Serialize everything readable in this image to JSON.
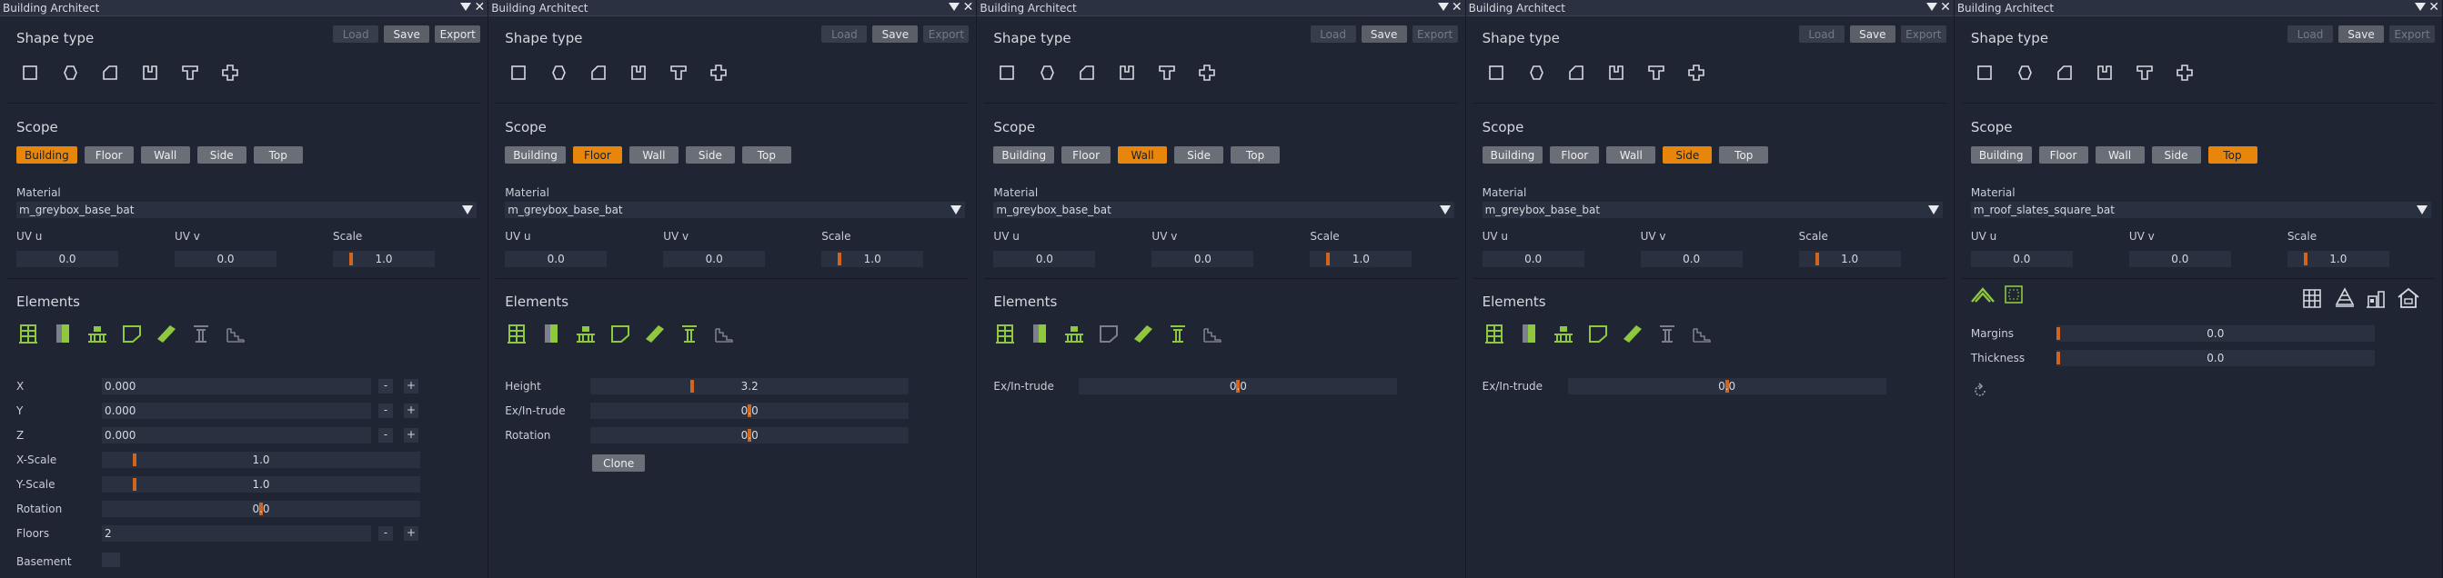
{
  "colors": {
    "accent": "#e8860c",
    "slider_mark": "#d0651f",
    "panel_bg": "#1f2533",
    "field_bg": "#293040",
    "button": "#6a6e76",
    "icon_green": "#8fc83e",
    "icon_gray": "#7b808a"
  },
  "panels": [
    {
      "title": "Building Architect",
      "buttons": {
        "load": "Load",
        "save": "Save",
        "export": "Export"
      },
      "shape_type_title": "Shape type",
      "scope_title": "Scope",
      "scopes": [
        "Building",
        "Floor",
        "Wall",
        "Side",
        "Top"
      ],
      "active_scope": "Building",
      "material_label": "Material",
      "material": "m_greybox_base_bat",
      "uv_u_label": "UV u",
      "uv_u": "0.0",
      "uv_v_label": "UV v",
      "uv_v": "0.0",
      "scale_label": "Scale",
      "scale": "1.0",
      "elements_title": "Elements",
      "props": [
        {
          "label": "X",
          "value": "0.000",
          "minus": "-",
          "plus": "+"
        },
        {
          "label": "Y",
          "value": "0.000",
          "minus": "-",
          "plus": "+"
        },
        {
          "label": "Z",
          "value": "0.000",
          "minus": "-",
          "plus": "+"
        }
      ],
      "sliders": [
        {
          "label": "X-Scale",
          "value": "1.0",
          "level": 0.1
        },
        {
          "label": "Y-Scale",
          "value": "1.0",
          "level": 0.1
        },
        {
          "label": "Rotation",
          "value": "0.0",
          "level": 0.5
        }
      ],
      "floors": {
        "label": "Floors",
        "value": "2",
        "minus": "-",
        "plus": "+"
      },
      "basement_label": "Basement"
    },
    {
      "title": "Building Architect",
      "buttons": {
        "load": "Load",
        "save": "Save",
        "export": "Export"
      },
      "shape_type_title": "Shape type",
      "scope_title": "Scope",
      "scopes": [
        "Building",
        "Floor",
        "Wall",
        "Side",
        "Top"
      ],
      "active_scope": "Floor",
      "material_label": "Material",
      "material": "m_greybox_base_bat",
      "uv_u_label": "UV u",
      "uv_u": "0.0",
      "uv_v_label": "UV v",
      "uv_v": "0.0",
      "scale_label": "Scale",
      "scale": "1.0",
      "elements_title": "Elements",
      "sliders": [
        {
          "label": "Height",
          "value": "3.2",
          "level": 0.32
        },
        {
          "label": "Ex/In-trude",
          "value": "0.0",
          "level": 0.5
        },
        {
          "label": "Rotation",
          "value": "0.0",
          "level": 0.5
        }
      ],
      "clone_label": "Clone"
    },
    {
      "title": "Building Architect",
      "buttons": {
        "load": "Load",
        "save": "Save",
        "export": "Export"
      },
      "shape_type_title": "Shape type",
      "scope_title": "Scope",
      "scopes": [
        "Building",
        "Floor",
        "Wall",
        "Side",
        "Top"
      ],
      "active_scope": "Wall",
      "material_label": "Material",
      "material": "m_greybox_base_bat",
      "uv_u_label": "UV u",
      "uv_u": "0.0",
      "uv_v_label": "UV v",
      "uv_v": "0.0",
      "scale_label": "Scale",
      "scale": "1.0",
      "elements_title": "Elements",
      "sliders": [
        {
          "label": "Ex/In-trude",
          "value": "0.0",
          "level": 0.5
        }
      ]
    },
    {
      "title": "Building Architect",
      "buttons": {
        "load": "Load",
        "save": "Save",
        "export": "Export"
      },
      "shape_type_title": "Shape type",
      "scope_title": "Scope",
      "scopes": [
        "Building",
        "Floor",
        "Wall",
        "Side",
        "Top"
      ],
      "active_scope": "Side",
      "material_label": "Material",
      "material": "m_greybox_base_bat",
      "uv_u_label": "UV u",
      "uv_u": "0.0",
      "uv_v_label": "UV v",
      "uv_v": "0.0",
      "scale_label": "Scale",
      "scale": "1.0",
      "elements_title": "Elements",
      "sliders": [
        {
          "label": "Ex/In-trude",
          "value": "0.0",
          "level": 0.5
        }
      ]
    },
    {
      "title": "Building Architect",
      "buttons": {
        "load": "Load",
        "save": "Save",
        "export": "Export"
      },
      "shape_type_title": "Shape type",
      "scope_title": "Scope",
      "scopes": [
        "Building",
        "Floor",
        "Wall",
        "Side",
        "Top"
      ],
      "active_scope": "Top",
      "material_label": "Material",
      "material": "m_roof_slates_square_bat",
      "uv_u_label": "UV u",
      "uv_u": "0.0",
      "uv_v_label": "UV v",
      "uv_v": "0.0",
      "scale_label": "Scale",
      "scale": "1.0",
      "sliders": [
        {
          "label": "Margins",
          "value": "0.0",
          "level": 0.0
        },
        {
          "label": "Thickness",
          "value": "0.0",
          "level": 0.0
        }
      ]
    }
  ]
}
